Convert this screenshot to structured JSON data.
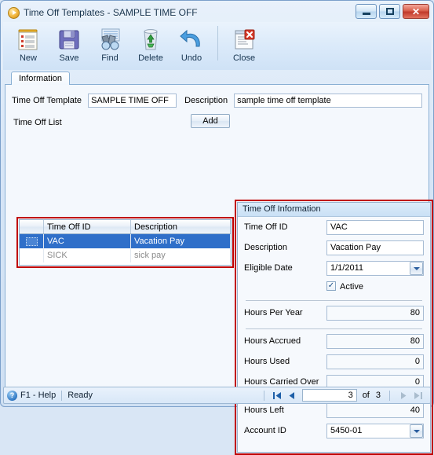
{
  "window": {
    "title": "Time Off Templates - SAMPLE TIME OFF",
    "app_icon": "play-circle-icon",
    "minimize_label": "–",
    "maximize_label": "□",
    "close_label": "✕"
  },
  "toolbar": {
    "items": [
      {
        "label": "New",
        "icon": "new-document-icon"
      },
      {
        "label": "Save",
        "icon": "floppy-disk-icon"
      },
      {
        "label": "Find",
        "icon": "binoculars-icon"
      },
      {
        "label": "Delete",
        "icon": "recycle-bin-icon"
      },
      {
        "label": "Undo",
        "icon": "undo-arrow-icon"
      },
      {
        "label": "Close",
        "icon": "close-document-icon"
      }
    ]
  },
  "tabs": [
    {
      "label": "Information",
      "selected": true
    }
  ],
  "form": {
    "template_label": "Time Off Template",
    "template_value": "SAMPLE TIME OFF",
    "description_label": "Description",
    "description_value": "sample time off template"
  },
  "list_section": {
    "label": "Time Off List",
    "add_button": "Add",
    "columns": [
      "",
      "Time Off ID",
      "Description"
    ],
    "rows": [
      {
        "id": "VAC",
        "description": "Vacation Pay",
        "selected": true
      },
      {
        "id": "SICK",
        "description": "sick pay",
        "selected": false
      }
    ]
  },
  "info_panel": {
    "header": "Time Off Information",
    "fields": [
      {
        "label": "Time Off ID",
        "value": "VAC",
        "type": "text"
      },
      {
        "label": "Description",
        "value": "Vacation Pay",
        "type": "text"
      },
      {
        "label": "Eligible Date",
        "value": "1/1/2011",
        "type": "combo"
      }
    ],
    "checkbox": {
      "label": "Active",
      "checked": true,
      "mark": "✓"
    },
    "hours_per_year": {
      "label": "Hours Per Year",
      "value": "80"
    },
    "accrual": [
      {
        "label": "Hours Accrued",
        "value": "80"
      },
      {
        "label": "Hours Used",
        "value": "0"
      },
      {
        "label": "Hours Carried Over",
        "value": "0"
      }
    ],
    "totals": [
      {
        "label": "Hours Left",
        "value": "40",
        "type": "num"
      }
    ],
    "account": {
      "label": "Account ID",
      "value": "5450-01",
      "type": "combo"
    }
  },
  "highlights": {
    "list_box_color": "#c00000",
    "info_box_color": "#c00000"
  },
  "statusbar": {
    "help_icon": "help-circle-icon",
    "help_text": "F1 - Help",
    "status_text": "Ready",
    "nav": {
      "first_icon": "nav-first-icon",
      "prev_icon": "nav-prev-icon",
      "current": "3",
      "of_label": "of",
      "total": "3",
      "next_icon": "nav-next-icon",
      "last_icon": "nav-last-icon"
    }
  },
  "colors": {
    "selection_blue": "#2f6fc9",
    "frame_blue": "#7ba0cb",
    "highlight_red": "#c00000"
  }
}
